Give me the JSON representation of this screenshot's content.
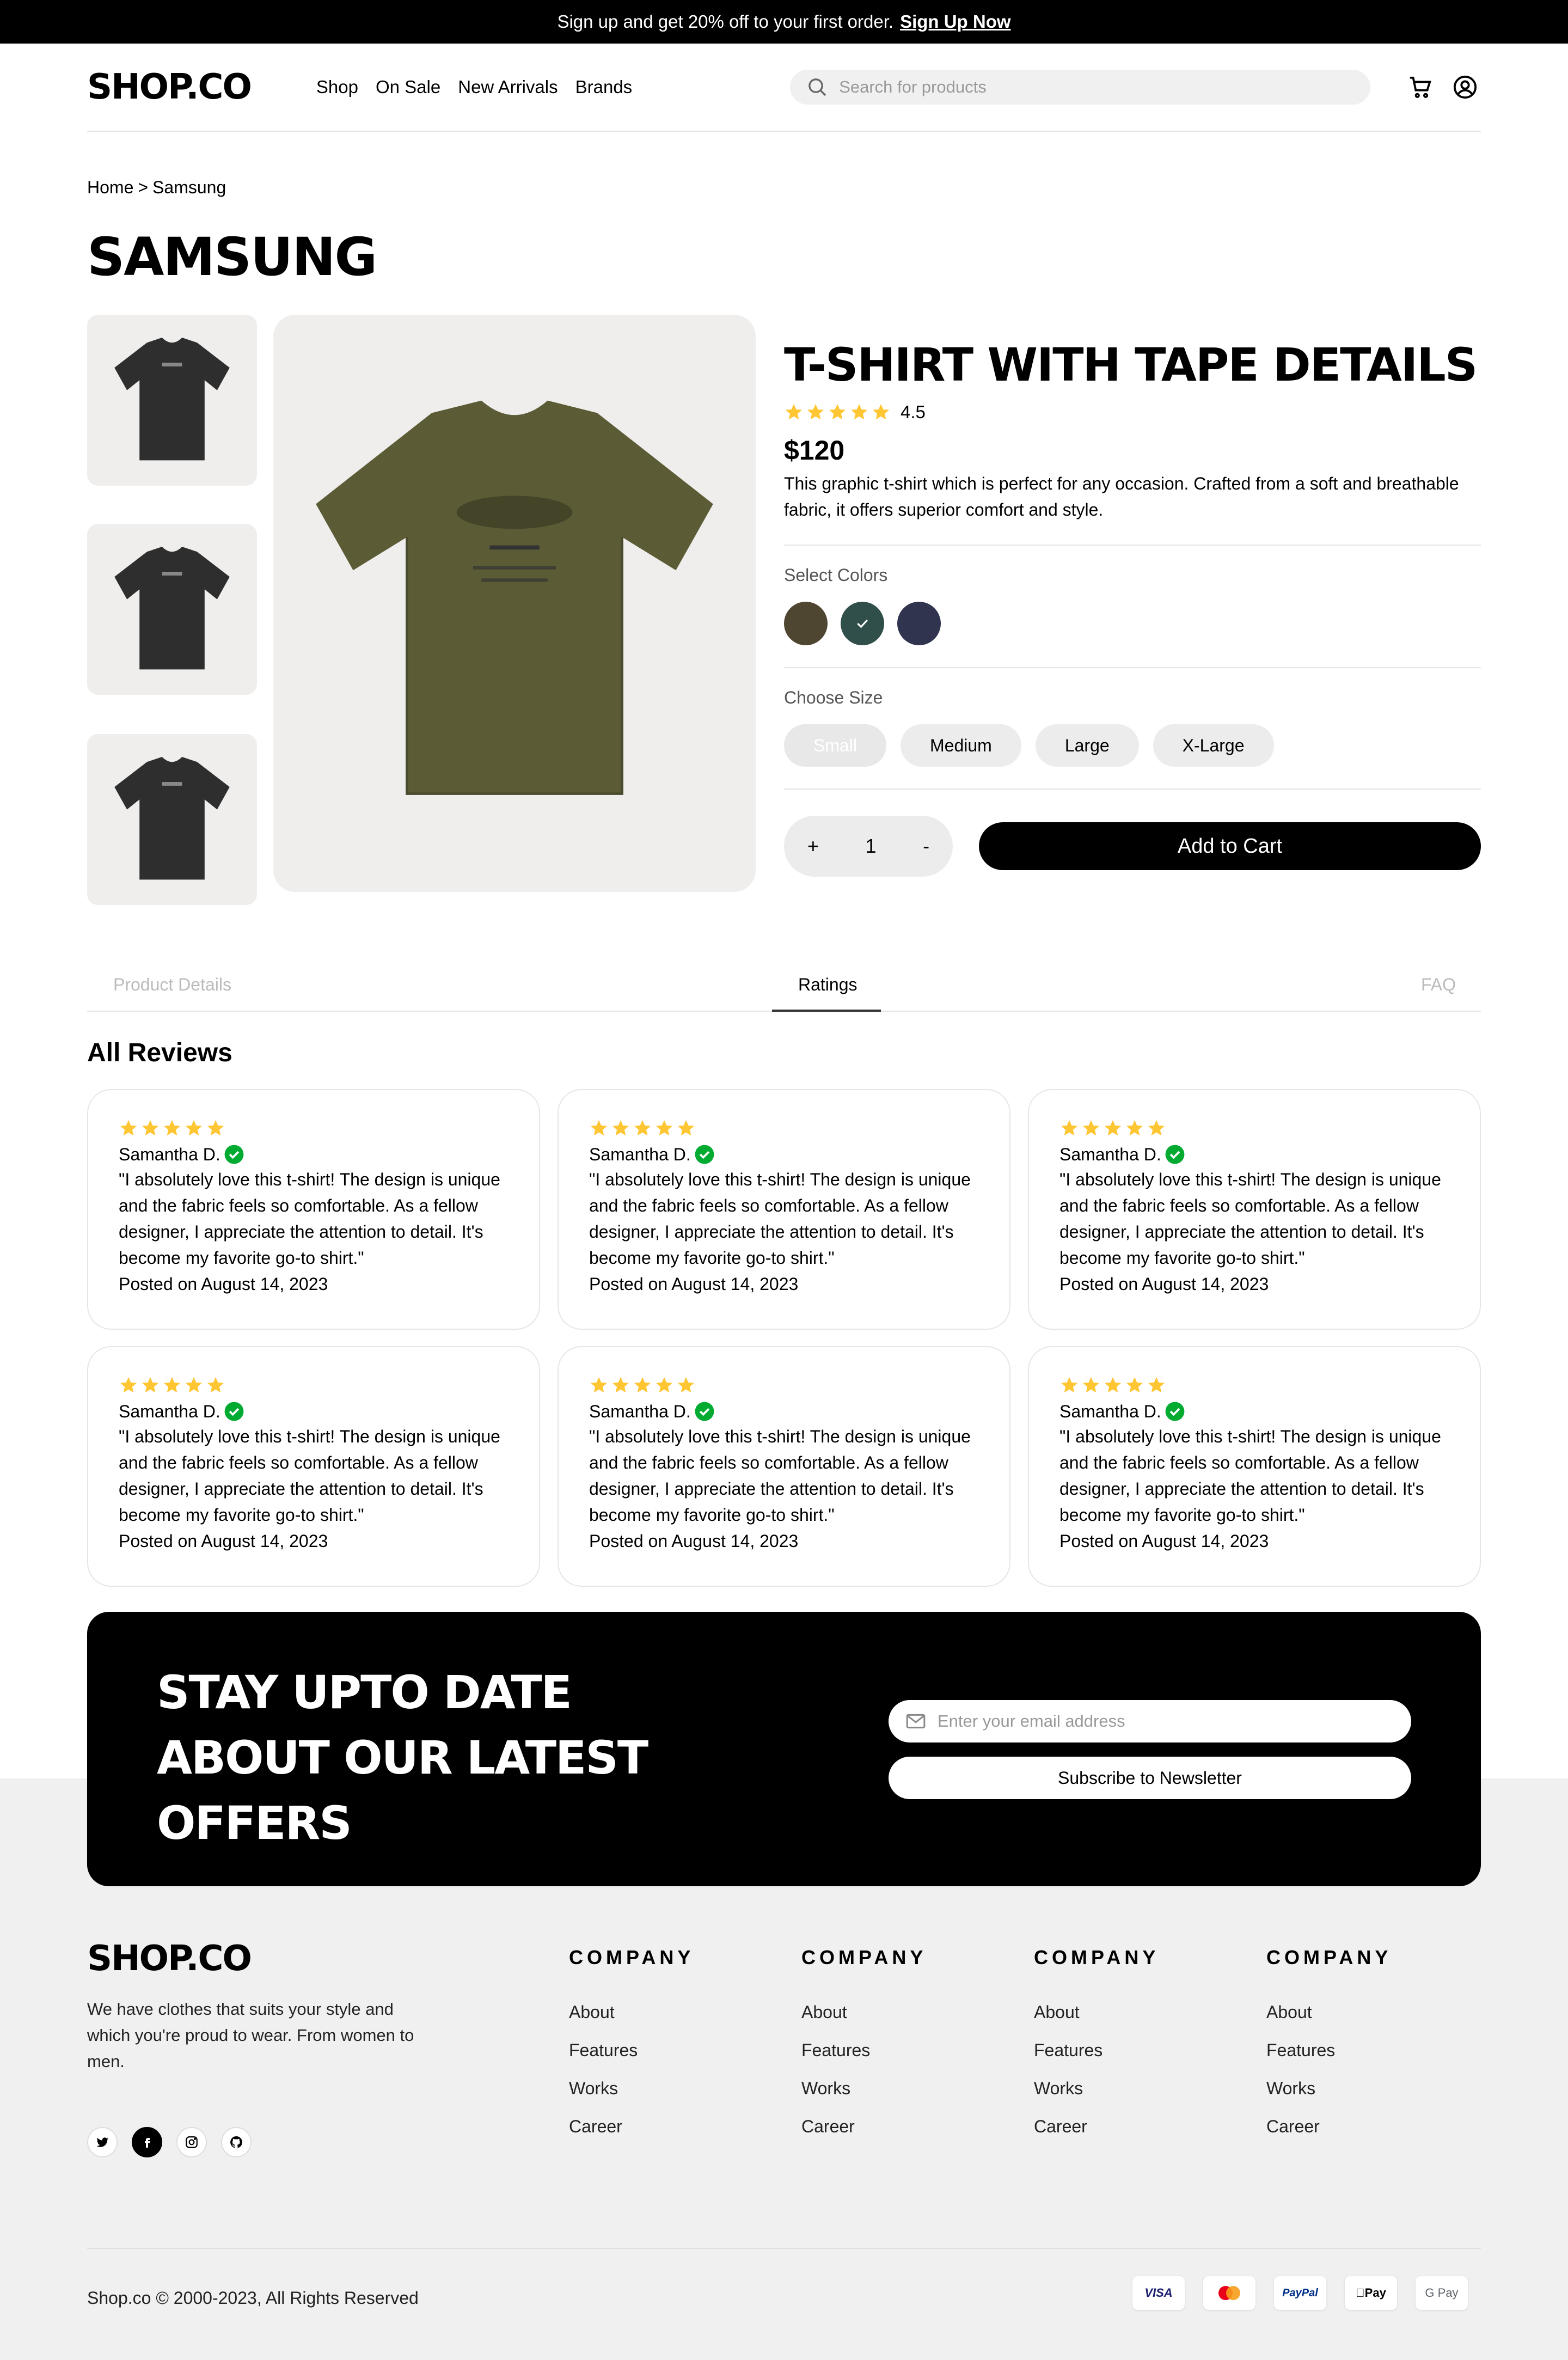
{
  "banner": {
    "text": "Sign up and get 20% off to your first order.",
    "link": "Sign Up Now"
  },
  "header": {
    "logo": "SHOP.CO",
    "nav": [
      "Shop",
      "On Sale",
      "New Arrivals",
      "Brands"
    ],
    "search_placeholder": "Search for products"
  },
  "breadcrumb": {
    "home": "Home",
    "separator": ">",
    "current": "Samsung"
  },
  "brand_title": "SAMSUNG",
  "product": {
    "title": "T-SHIRT WITH TAPE DETAILS",
    "rating": "4.5",
    "rating_value": 4.5,
    "price": "$120",
    "description": "This graphic t-shirt which is perfect for any occasion. Crafted from a soft and breathable fabric, it offers superior comfort and style.",
    "colors_label": "Select Colors",
    "colors": [
      "#4f4631",
      "#314f4a",
      "#31344f"
    ],
    "selected_color_index": 1,
    "sizes_label": "Choose Size",
    "sizes": [
      "Small",
      "Medium",
      "Large",
      "X-Large"
    ],
    "selected_size_index": 0,
    "quantity": "1",
    "qty_plus": "+",
    "qty_minus": "-",
    "add_to_cart": "Add to Cart"
  },
  "tabs": {
    "details": "Product Details",
    "ratings": "Ratings",
    "faq": "FAQ"
  },
  "reviews_heading": "All Reviews",
  "reviews": [
    {
      "name": "Samantha D.",
      "text": "\"I absolutely love this t-shirt! The design is unique and the fabric feels so comfortable. As a fellow designer, I appreciate the attention to detail. It's become my favorite go-to shirt.\"",
      "date": "Posted on August 14, 2023"
    },
    {
      "name": "Samantha D.",
      "text": "\"I absolutely love this t-shirt! The design is unique and the fabric feels so comfortable. As a fellow designer, I appreciate the attention to detail. It's become my favorite go-to shirt.\"",
      "date": "Posted on August 14, 2023"
    },
    {
      "name": "Samantha D.",
      "text": "\"I absolutely love this t-shirt! The design is unique and the fabric feels so comfortable. As a fellow designer, I appreciate the attention to detail. It's become my favorite go-to shirt.\"",
      "date": "Posted on August 14, 2023"
    },
    {
      "name": "Samantha D.",
      "text": "\"I absolutely love this t-shirt! The design is unique and the fabric feels so comfortable. As a fellow designer, I appreciate the attention to detail. It's become my favorite go-to shirt.\"",
      "date": "Posted on August 14, 2023"
    },
    {
      "name": "Samantha D.",
      "text": "\"I absolutely love this t-shirt! The design is unique and the fabric feels so comfortable. As a fellow designer, I appreciate the attention to detail. It's become my favorite go-to shirt.\"",
      "date": "Posted on August 14, 2023"
    },
    {
      "name": "Samantha D.",
      "text": "\"I absolutely love this t-shirt! The design is unique and the fabric feels so comfortable. As a fellow designer, I appreciate the attention to detail. It's become my favorite go-to shirt.\"",
      "date": "Posted on August 14, 2023"
    }
  ],
  "newsletter": {
    "title": "STAY UPTO DATE ABOUT OUR LATEST OFFERS",
    "email_placeholder": "Enter your email address",
    "button": "Subscribe to Newsletter"
  },
  "footer": {
    "logo": "SHOP.CO",
    "description": "We have clothes that suits your style and which you're proud to wear. From women to men.",
    "social": [
      "twitter-icon",
      "facebook-icon",
      "instagram-icon",
      "github-icon"
    ],
    "columns": [
      {
        "heading": "COMPANY",
        "links": [
          "About",
          "Features",
          "Works",
          "Career"
        ]
      },
      {
        "heading": "COMPANY",
        "links": [
          "About",
          "Features",
          "Works",
          "Career"
        ]
      },
      {
        "heading": "COMPANY",
        "links": [
          "About",
          "Features",
          "Works",
          "Career"
        ]
      },
      {
        "heading": "COMPANY",
        "links": [
          "About",
          "Features",
          "Works",
          "Career"
        ]
      }
    ],
    "copyright": "Shop.co © 2000-2023, All Rights Reserved",
    "payments": [
      "VISA",
      "mastercard-icon",
      "PayPal",
      "Pay",
      "G Pay"
    ]
  },
  "colors": {
    "star": "#ffc633",
    "verified": "#01ab31",
    "accent": "#000000"
  }
}
